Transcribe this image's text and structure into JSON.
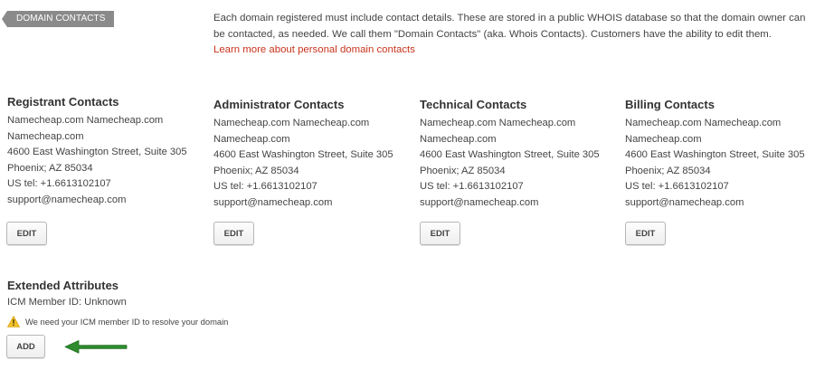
{
  "section": {
    "tag_label": "DOMAIN CONTACTS"
  },
  "intro": {
    "text": "Each domain registered must include contact details. These are stored in a public WHOIS database so that the domain owner can be contacted, as needed. We call them \"Domain Contacts\" (aka. Whois Contacts). Customers have the ability to edit them.",
    "link_label": "Learn more about personal domain contacts"
  },
  "contacts": [
    {
      "title": "Registrant Contacts",
      "name": "Namecheap.com Namecheap.com",
      "org": "Namecheap.com",
      "address": "4600 East Washington Street, Suite 305",
      "city": "Phoenix; AZ 85034",
      "phone": "US tel: +1.6613102107",
      "email": "support@namecheap.com",
      "button_label": "EDIT"
    },
    {
      "title": "Administrator Contacts",
      "name": "Namecheap.com Namecheap.com",
      "org": "Namecheap.com",
      "address": "4600 East Washington Street, Suite 305",
      "city": "Phoenix; AZ 85034",
      "phone": "US tel: +1.6613102107",
      "email": "support@namecheap.com",
      "button_label": "EDIT"
    },
    {
      "title": "Technical Contacts",
      "name": "Namecheap.com Namecheap.com",
      "org": "Namecheap.com",
      "address": "4600 East Washington Street, Suite 305",
      "city": "Phoenix; AZ 85034",
      "phone": "US tel: +1.6613102107",
      "email": "support@namecheap.com",
      "button_label": "EDIT"
    },
    {
      "title": "Billing Contacts",
      "name": "Namecheap.com Namecheap.com",
      "org": "Namecheap.com",
      "address": "4600 East Washington Street, Suite 305",
      "city": "Phoenix; AZ 85034",
      "phone": "US tel: +1.6613102107",
      "email": "support@namecheap.com",
      "button_label": "EDIT"
    }
  ],
  "extended": {
    "title": "Extended Attributes",
    "member_id": "ICM Member ID: Unknown",
    "warning_text": "We need your ICM member ID to resolve your domain",
    "add_label": "ADD"
  },
  "colors": {
    "tag_bg": "#8a8a8a",
    "link": "#c8331c",
    "warning": "#f2c12e",
    "arrow": "#2e8b2e"
  },
  "icons": {
    "warning": "warning-icon",
    "arrow": "arrow-left-icon"
  }
}
